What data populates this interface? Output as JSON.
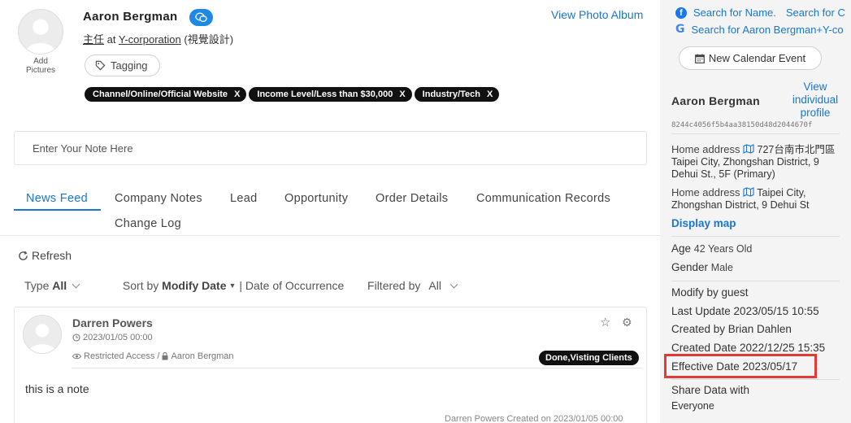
{
  "profile": {
    "name": "Aaron Bergman",
    "add_pictures": "Add Pictures",
    "title": "主任",
    "at": "at",
    "company": "Y-corporation",
    "dept": "(視覺設計)",
    "view_album": "View Photo Album",
    "tagging_label": "Tagging",
    "chips": [
      {
        "label": "Channel/Online/Official Website",
        "x": "X"
      },
      {
        "label": "Income Level/Less than $30,000",
        "x": "X"
      },
      {
        "label": "Industry/Tech",
        "x": "X"
      }
    ]
  },
  "note": {
    "placeholder": "Enter Your Note Here"
  },
  "tabs": [
    "News Feed",
    "Company Notes",
    "Lead",
    "Opportunity",
    "Order Details",
    "Communication Records",
    "Change Log"
  ],
  "toolbar": {
    "refresh": "Refresh",
    "type_label": "Type",
    "type_value": "All",
    "sort_label": "Sort by",
    "sort_value": "Modify Date",
    "sort_sep": "|",
    "sort_alt": "Date of Occurrence",
    "filter_label": "Filtered by",
    "filter_value": "All"
  },
  "feed_card": {
    "author": "Darren Powers",
    "date": "2023/01/05 00:00",
    "access": "Restricted Access",
    "access_sep": "/",
    "owner": "Aaron Bergman",
    "badge": "Done,Visting Clients",
    "body": "this is a note",
    "footer": "Darren Powers Created on 2023/01/05 00:00"
  },
  "side": {
    "fb_search_1": "Search for Name.",
    "fb_search_2": "Search for C",
    "google_search": "Search for Aaron Bergman+Y-co",
    "calendar_btn": "New Calendar Event",
    "name": "Aaron Bergman",
    "view_profile": "View individual profile",
    "hash": "8244c4056f5b4aa38150d48d2044670f",
    "addr1_label": "Home address",
    "addr1_text": "727台南市北門區 Taipei City, Zhongshan District, 9 Dehui St., 5F",
    "addr1_primary": "(Primary)",
    "addr2_label": "Home address",
    "addr2_text": "Taipei City, Zhongshan District, 9 Dehui St",
    "display_map": "Display map",
    "age_label": "Age",
    "age_value": "42 Years Old",
    "gender_label": "Gender",
    "gender_value": "Male",
    "modify_by": "Modify by guest",
    "last_update": "Last Update 2023/05/15 10:55",
    "created_by": "Created by Brian Dahlen",
    "created_date": "Created Date 2022/12/25 15:35",
    "effective_date": "Effective Date 2023/05/17",
    "share_label": "Share Data with",
    "share_value": "Everyone"
  },
  "colors": {
    "accent": "#1976d2",
    "highlight": "#e53935",
    "chip": "#111111"
  }
}
